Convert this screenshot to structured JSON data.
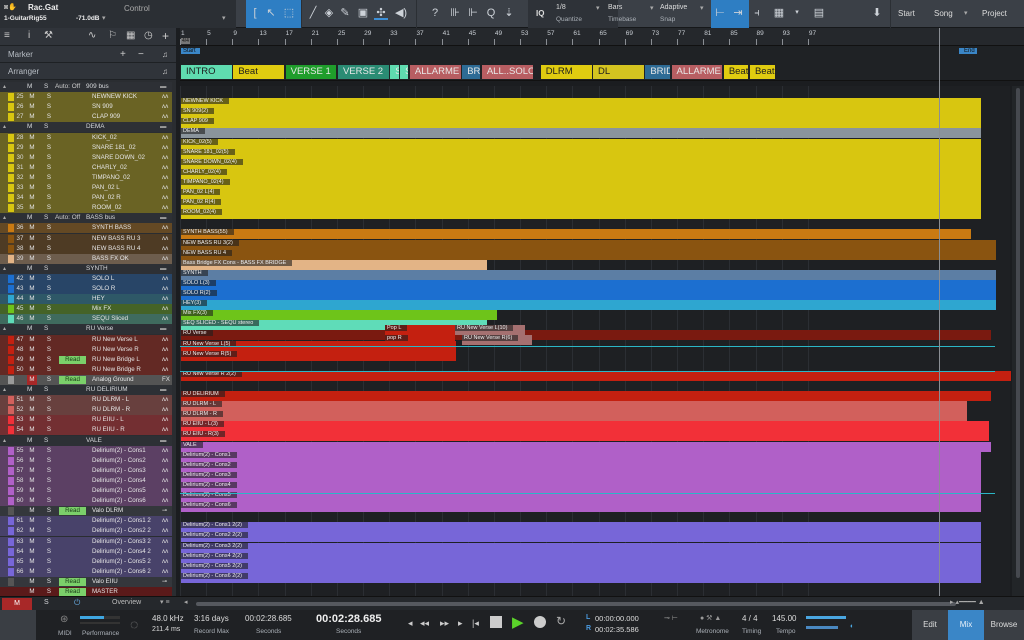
{
  "top": {
    "track_name": "Rac.Gat",
    "insert": "1-GuitarRig55",
    "level": "-71.0dB",
    "control_label": "Control",
    "quantize_value": "1/8",
    "quantize_label": "Quantize",
    "timebase_value": "Bars",
    "timebase_label": "Timebase",
    "snap_value": "Adaptive",
    "snap_label": "Snap",
    "iq_label": "IQ",
    "start_label": "Start",
    "song_label": "Song",
    "project_label": "Project"
  },
  "left": {
    "marker_label": "Marker",
    "arranger_label": "Arranger"
  },
  "ruler": {
    "bars": [
      "1",
      "5",
      "9",
      "13",
      "17",
      "21",
      "25",
      "29",
      "33",
      "37",
      "41",
      "45",
      "49",
      "53",
      "57",
      "61",
      "65",
      "69",
      "73",
      "77",
      "81",
      "85",
      "89",
      "93",
      "97"
    ],
    "time_sig": "4/4",
    "start_marker": "Start",
    "end_marker": "End"
  },
  "arranger": [
    {
      "label": "INTRO",
      "color": "#5fdcb0"
    },
    {
      "label": "Beat",
      "color": "#e0cc10"
    },
    {
      "label": "VERSE 1",
      "color": "#1f9d2b"
    },
    {
      "label": "VERSE 2",
      "color": "#2a8c74"
    },
    {
      "label": "SI",
      "color": "#5fdcb0"
    },
    {
      "label": "SI",
      "color": "#5fdcb0"
    },
    {
      "label": "ALLARME",
      "color": "#b85e62"
    },
    {
      "label": "BRIDGE",
      "color": "#2d6b95"
    },
    {
      "label": "ALL..SOLO",
      "color": "#b85e62"
    },
    {
      "label": "DLRM",
      "color": "#e0cc10"
    },
    {
      "label": "DL",
      "color": "#d4c420"
    },
    {
      "label": "BRIDGE",
      "color": "#2d6b95"
    },
    {
      "label": "ALLARME",
      "color": "#b85e62"
    },
    {
      "label": "Beat",
      "color": "#e0cc10"
    },
    {
      "label": "Beat",
      "color": "#e0cc10"
    }
  ],
  "tracks": [
    {
      "type": "folder",
      "name": "909 bus",
      "auto": "Auto: Off",
      "color": "#3d3f22"
    },
    {
      "type": "track",
      "num": "25",
      "name": "NEWNEW KICK",
      "color": "#d8c610",
      "clip": "NEWNEW KICK"
    },
    {
      "type": "track",
      "num": "26",
      "name": "SN 909",
      "color": "#d8c610",
      "clip": "SN 909(2)"
    },
    {
      "type": "track",
      "num": "27",
      "name": "CLAP 909",
      "color": "#d8c610",
      "clip": "CLAP 909"
    },
    {
      "type": "folder",
      "name": "DEMA",
      "auto": "",
      "color": "#3d3f22",
      "clip": "DEMA"
    },
    {
      "type": "track",
      "num": "28",
      "name": "KICK_02",
      "color": "#d8c610",
      "clip": "KICK_02(5)"
    },
    {
      "type": "track",
      "num": "29",
      "name": "SNARE 181_02",
      "color": "#d8c610",
      "clip": "SNARE 181_02(5)"
    },
    {
      "type": "track",
      "num": "30",
      "name": "SNARE DOWN_02",
      "color": "#d8c610",
      "clip": "SNARE DOWN_02(4)"
    },
    {
      "type": "track",
      "num": "31",
      "name": "CHARLY_02",
      "color": "#d8c610",
      "clip": "CHARLY_02(4)"
    },
    {
      "type": "track",
      "num": "32",
      "name": "TIMPANO_02",
      "color": "#d8c610",
      "clip": "TIMPANO_02(4)"
    },
    {
      "type": "track",
      "num": "33",
      "name": "PAN_02 L",
      "color": "#d8c610",
      "clip": "PAN_02 L(4)"
    },
    {
      "type": "track",
      "num": "34",
      "name": "PAN_02 R",
      "color": "#d8c610",
      "clip": "PAN_02 R(4)"
    },
    {
      "type": "track",
      "num": "35",
      "name": "ROOM_02",
      "color": "#d8c610",
      "clip": "ROOM_02(4)"
    },
    {
      "type": "folder",
      "name": "BASS bus",
      "auto": "Auto: Off",
      "color": "#3a3226"
    },
    {
      "type": "track",
      "num": "36",
      "name": "SYNTH BASS",
      "color": "#c97a12",
      "clip": "SYNTH BASS(55)"
    },
    {
      "type": "track",
      "num": "37",
      "name": "NEW BASS RU 3",
      "color": "#8a5410",
      "clip": "NEW BASS RU 3(2)"
    },
    {
      "type": "track",
      "num": "38",
      "name": "NEW BASS RU 4",
      "color": "#8a5410",
      "clip": "NEW BASS RU 4"
    },
    {
      "type": "track",
      "num": "39",
      "name": "BASS FX OK",
      "color": "#e3b486",
      "clip": "Bass Bridge FX Cons - BASS FX BRIDGE"
    },
    {
      "type": "folder",
      "name": "SYNTH",
      "auto": "",
      "color": "#2b3540",
      "clip": "SYNTH"
    },
    {
      "type": "track",
      "num": "42",
      "name": "SOLO L",
      "color": "#1c6fd0",
      "clip": "SOLO L(3)"
    },
    {
      "type": "track",
      "num": "43",
      "name": "SOLO R",
      "color": "#1c6fd0",
      "clip": "SOLO R(2)"
    },
    {
      "type": "track",
      "num": "44",
      "name": "HEY",
      "color": "#2ea6d0",
      "clip": "HEY(3)"
    },
    {
      "type": "track",
      "num": "45",
      "name": "Mix FX",
      "color": "#6ec41a",
      "clip": "Mix FX(3)"
    },
    {
      "type": "track",
      "num": "46",
      "name": "SEQU Sliced",
      "color": "#5fdcb8",
      "clip": "SEQ SLICED - SEQU stereo"
    },
    {
      "type": "folder",
      "name": "RU Verse",
      "auto": "",
      "color": "#3c2222",
      "clip": "RU Verse"
    },
    {
      "type": "track",
      "num": "47",
      "name": "RU New Verse L",
      "color": "#c42010",
      "clip": "RU New Verse L(5)"
    },
    {
      "type": "track",
      "num": "48",
      "name": "RU New Verse R",
      "color": "#c42010",
      "clip": "RU New Verse R(5)"
    },
    {
      "type": "track",
      "num": "49",
      "name": "RU New Bridge L",
      "color": "#c42010",
      "read": "Read"
    },
    {
      "type": "track",
      "num": "50",
      "name": "RU New Bridge R",
      "color": "#c42010",
      "clip": "RU New Verse R 2(2)"
    },
    {
      "type": "fx",
      "num": "",
      "name": "Analog Ground",
      "color": "#9a9a9a",
      "read": "Read",
      "ic": "FX"
    },
    {
      "type": "folder",
      "name": "RU DELIRIUM",
      "auto": "",
      "color": "#3c2222",
      "clip": "RU DELIRIUM"
    },
    {
      "type": "track",
      "num": "51",
      "name": "RU DLRM - L",
      "color": "#d2605c",
      "clip": "RU DLRM - L"
    },
    {
      "type": "track",
      "num": "52",
      "name": "RU DLRM - R",
      "color": "#d2605c",
      "clip": "RU DLRM - R"
    },
    {
      "type": "track",
      "num": "53",
      "name": "RU EIIU - L",
      "color": "#f23038",
      "clip": "RU EIIU - L(3)"
    },
    {
      "type": "track",
      "num": "54",
      "name": "RU EIIU - R",
      "color": "#f23038",
      "clip": "RU EIIU - R(3)"
    },
    {
      "type": "folder",
      "name": "VALE",
      "auto": "",
      "color": "#352440",
      "clip": "VALE"
    },
    {
      "type": "track",
      "num": "55",
      "name": "Delirium(2) - Cons1",
      "color": "#b060c8",
      "clip": "Delirium(2) - Cons1"
    },
    {
      "type": "track",
      "num": "56",
      "name": "Delirium(2) - Cons2",
      "color": "#b060c8",
      "clip": "Delirium(2) - Cons2"
    },
    {
      "type": "track",
      "num": "57",
      "name": "Delirium(2) - Cons3",
      "color": "#b060c8",
      "clip": "Delirium(2) - Cons3"
    },
    {
      "type": "track",
      "num": "58",
      "name": "Delirium(2) - Cons4",
      "color": "#b060c8",
      "clip": "Delirium(2) - Cons4"
    },
    {
      "type": "track",
      "num": "59",
      "name": "Delirium(2) - Cons5",
      "color": "#b060c8",
      "clip": "Delirium(2) - Cons5"
    },
    {
      "type": "track",
      "num": "60",
      "name": "Delirium(2) - Cons6",
      "color": "#b060c8",
      "clip": "Delirium(2) - Cons6"
    },
    {
      "type": "auto",
      "num": "",
      "name": "Valo DLRM",
      "color": "#555",
      "read": "Read"
    },
    {
      "type": "track",
      "num": "61",
      "name": "Delirium(2) - Cons1 2",
      "color": "#7766d8",
      "clip": "Delirium(2) - Cons1 2(2)"
    },
    {
      "type": "track",
      "num": "62",
      "name": "Delirium(2) - Cons2 2",
      "color": "#7766d8",
      "clip": "Delirium(2) - Cons2 2(2)"
    },
    {
      "type": "track",
      "num": "63",
      "name": "Delirium(2) - Cons3 2",
      "color": "#7766d8",
      "clip": "Delirium(2) - Cons3 2(2)"
    },
    {
      "type": "track",
      "num": "64",
      "name": "Delirium(2) - Cons4 2",
      "color": "#7766d8",
      "clip": "Delirium(2) - Cons4 2(2)"
    },
    {
      "type": "track",
      "num": "65",
      "name": "Delirium(2) - Cons5 2",
      "color": "#7766d8",
      "clip": "Delirium(2) - Cons5 2(2)"
    },
    {
      "type": "track",
      "num": "66",
      "name": "Delirium(2) - Cons6 2",
      "color": "#7766d8",
      "clip": "Delirium(2) - Cons6 2(2)"
    },
    {
      "type": "auto",
      "num": "",
      "name": "Valo EIIU",
      "color": "#555",
      "read": "Read"
    },
    {
      "type": "master",
      "num": "",
      "name": "MASTER",
      "color": "#5a1a1a",
      "read": "Read"
    }
  ],
  "extra_clips": {
    "pop_l": "Pop L",
    "pop_r": "pop R",
    "ru_verse_l10": "RU New Verse L(10)",
    "ru_verse_r6": "RU New Verse R(6)",
    "snare_down": "SNARE DOWN_02(4)"
  },
  "buttons": {
    "m": "M",
    "s": "S",
    "read": "Read"
  },
  "bottom": {
    "m_label": "M",
    "s_label": "S",
    "overview_label": "Overview",
    "midi_label": "MIDI",
    "performance_label": "Performance",
    "sample_rate": "48.0 kHz",
    "latency": "211.4 ms",
    "record_max_value": "3:16 days",
    "record_max_label": "Record Max",
    "seconds_small": "00:02:28.685",
    "seconds_small_label": "Seconds",
    "time_main": "00:02:28.685",
    "time_main_label": "Seconds",
    "loop_l_label": "L",
    "loop_l": "00:00:00.000",
    "loop_r_label": "R",
    "loop_r": "00:02:35.586",
    "metronome_label": "Metronome",
    "timing_value": "4 / 4",
    "timing_label": "Timing",
    "tempo_value": "145.00",
    "tempo_label": "Tempo",
    "edit_label": "Edit",
    "mix_label": "Mix",
    "browse_label": "Browse",
    "performance_level": 0.6
  }
}
